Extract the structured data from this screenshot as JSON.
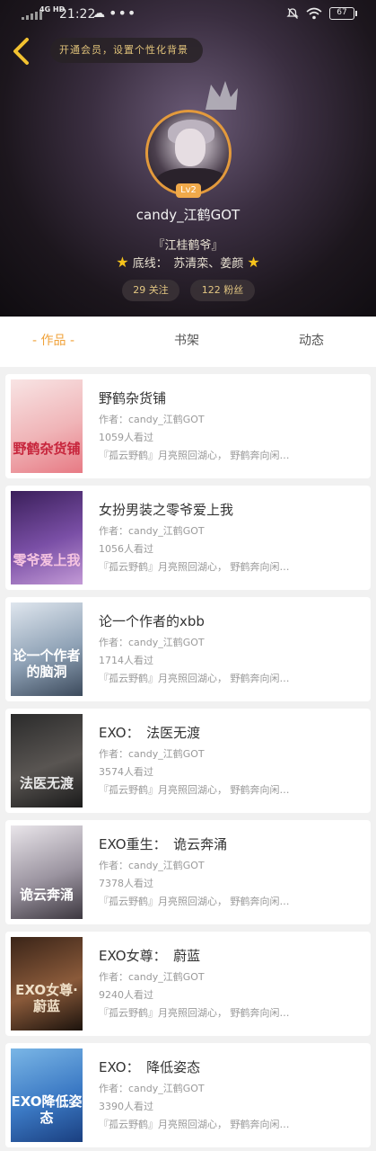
{
  "status_bar": {
    "network": "4G HD",
    "time": "21:22",
    "battery": "67"
  },
  "header": {
    "vip_prompt": "开通会员，设置个性化背景",
    "level": "Lv2",
    "username": "candy_江鹤GOT",
    "motto": "『江桂鹤爷』",
    "bottomline": "底线：　苏清栾、姜颜",
    "following": "29 关注",
    "fans": "122 粉丝"
  },
  "tabs": [
    {
      "label": "- 作品 -"
    },
    {
      "label": "书架"
    },
    {
      "label": "动态"
    }
  ],
  "works": [
    {
      "title": "野鹤杂货铺",
      "author": "作者：candy_江鹤GOT",
      "reads": "1059人看过",
      "intro": "『孤云野鹤』月亮照回湖心， 野鹤奔向闲…",
      "cover_text": "野鹤杂货铺",
      "cover_colors": [
        "#f8e4e4",
        "#f0b5b8",
        "#e77a84"
      ],
      "cover_text_color": "#c7253c"
    },
    {
      "title": "女扮男装之零爷爱上我",
      "author": "作者：candy_江鹤GOT",
      "reads": "1056人看过",
      "intro": "『孤云野鹤』月亮照回湖心， 野鹤奔向闲…",
      "cover_text": "零爷爱上我",
      "cover_colors": [
        "#3a1f5a",
        "#7a4fa6",
        "#c39ad6"
      ],
      "cover_text_color": "#f6c4e0"
    },
    {
      "title": "论一个作者的xbb",
      "author": "作者：candy_江鹤GOT",
      "reads": "1714人看过",
      "intro": "『孤云野鹤』月亮照回湖心， 野鹤奔向闲…",
      "cover_text": "论一个作者的脑洞",
      "cover_colors": [
        "#dfe6ee",
        "#8fa2b6",
        "#3c4a5c"
      ],
      "cover_text_color": "#ffffff"
    },
    {
      "title": "EXO：　法医无渡",
      "author": "作者：candy_江鹤GOT",
      "reads": "3574人看过",
      "intro": "『孤云野鹤』月亮照回湖心， 野鹤奔向闲…",
      "cover_text": "法医无渡",
      "cover_colors": [
        "#2b2b2b",
        "#595552",
        "#1a1a1a"
      ],
      "cover_text_color": "#eaeaea"
    },
    {
      "title": "EXO重生：　诡云奔涌",
      "author": "作者：candy_江鹤GOT",
      "reads": "7378人看过",
      "intro": "『孤云野鹤』月亮照回湖心， 野鹤奔向闲…",
      "cover_text": "诡云奔涌",
      "cover_colors": [
        "#e9e5ea",
        "#9b94a0",
        "#3d3840"
      ],
      "cover_text_color": "#ffffff"
    },
    {
      "title": "EXO女尊：　蔚蓝",
      "author": "作者：candy_江鹤GOT",
      "reads": "9240人看过",
      "intro": "『孤云野鹤』月亮照回湖心， 野鹤奔向闲…",
      "cover_text": "EXO女尊·蔚蓝",
      "cover_colors": [
        "#3a2418",
        "#8a5a3a",
        "#1c130d"
      ],
      "cover_text_color": "#f0e0c8"
    },
    {
      "title": "EXO：　降低姿态",
      "author": "作者：candy_江鹤GOT",
      "reads": "3390人看过",
      "intro": "『孤云野鹤』月亮照回湖心， 野鹤奔向闲…",
      "cover_text": "EXO降低姿态",
      "cover_colors": [
        "#7ab6e6",
        "#3b79c4",
        "#1a3f80"
      ],
      "cover_text_color": "#ffffff"
    }
  ]
}
